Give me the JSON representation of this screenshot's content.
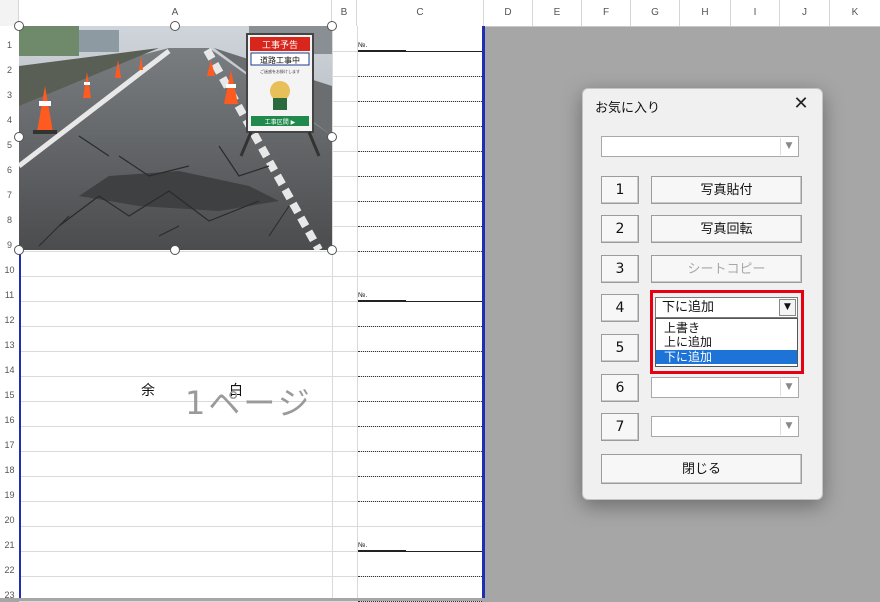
{
  "sheet": {
    "columns": [
      "A",
      "B",
      "C",
      "D",
      "E",
      "F",
      "G",
      "H",
      "I",
      "J",
      "K"
    ],
    "rows": [
      "1",
      "2",
      "3",
      "4",
      "5",
      "6",
      "7",
      "8",
      "9",
      "10",
      "11",
      "12",
      "13",
      "14",
      "15",
      "16",
      "17",
      "18",
      "19",
      "20",
      "21",
      "22",
      "23"
    ],
    "no_label": "№.",
    "margin_text": "余　白",
    "page_label": "1ページ",
    "photo_signboard": {
      "line1": "工事予告",
      "line2": "道路工事中",
      "line3": "ご迷惑をお掛けします",
      "line4": "工事区間 ▶"
    }
  },
  "dialog": {
    "title": "お気に入り",
    "close_glyph": "✕",
    "rows": [
      {
        "num": "1",
        "label": "写真貼付"
      },
      {
        "num": "2",
        "label": "写真回転"
      },
      {
        "num": "3",
        "label": "シートコピー"
      },
      {
        "num": "4"
      },
      {
        "num": "5"
      },
      {
        "num": "6"
      },
      {
        "num": "7"
      }
    ],
    "close_button": "閉じる",
    "insert_mode": {
      "selected": "下に追加",
      "options": [
        "上書き",
        "上に追加",
        "下に追加"
      ]
    },
    "arrow_glyph": "▼"
  },
  "colors": {
    "accent_red": "#e60012",
    "selection_blue": "#1e73d6",
    "print_border": "#1f2fb3"
  }
}
